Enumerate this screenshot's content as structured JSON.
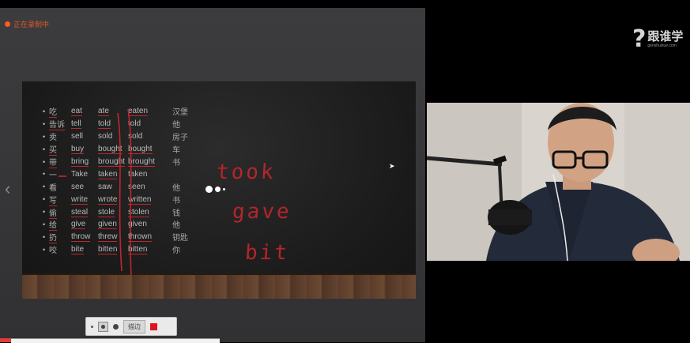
{
  "recording_status": "正在录制中",
  "slide": {
    "rows": [
      {
        "cn": "吃",
        "base": "eat",
        "past": "ate",
        "pp": "eaten",
        "note": "汉堡"
      },
      {
        "cn": "告诉",
        "base": "tell",
        "past": "told",
        "pp": "told",
        "note": "他"
      },
      {
        "cn": "卖",
        "base": "sell",
        "past": "sold",
        "pp": "sold",
        "note": "房子"
      },
      {
        "cn": "买",
        "base": "buy",
        "past": "bought",
        "pp": "bought",
        "note": "车"
      },
      {
        "cn": "带",
        "base": "bring",
        "past": "brought",
        "pp": "brought",
        "note": "书"
      },
      {
        "cn": "一",
        "base": "Take",
        "past": "taken",
        "pp": "taken",
        "note": ""
      },
      {
        "cn": "看",
        "base": "see",
        "past": "saw",
        "pp": "seen",
        "note": "他"
      },
      {
        "cn": "写",
        "base": "write",
        "past": "wrote",
        "pp": "written",
        "note": "书"
      },
      {
        "cn": "偷",
        "base": "steal",
        "past": "stole",
        "pp": "stolen",
        "note": "钱"
      },
      {
        "cn": "给",
        "base": "give",
        "past": "given",
        "pp": "given",
        "note": "他"
      },
      {
        "cn": "扔",
        "base": "throw",
        "past": "threw",
        "pp": "thrown",
        "note": "钥匙"
      },
      {
        "cn": "咬",
        "base": "bite",
        "past": "bitten",
        "pp": "bitten",
        "note": "你"
      }
    ],
    "handwriting": [
      "took",
      "gave",
      "bit"
    ]
  },
  "pen_toolbar": {
    "edge_label": "描边",
    "pen_color": "#e0141e"
  },
  "logo": {
    "main": "跟谁学",
    "sub": "genshuixue.com"
  },
  "colors": {
    "accent": "#c0262d",
    "recording": "#ff5a1f"
  },
  "icons": {
    "nav_prev": "chevron-left-icon",
    "recording": "record-dot-icon"
  }
}
